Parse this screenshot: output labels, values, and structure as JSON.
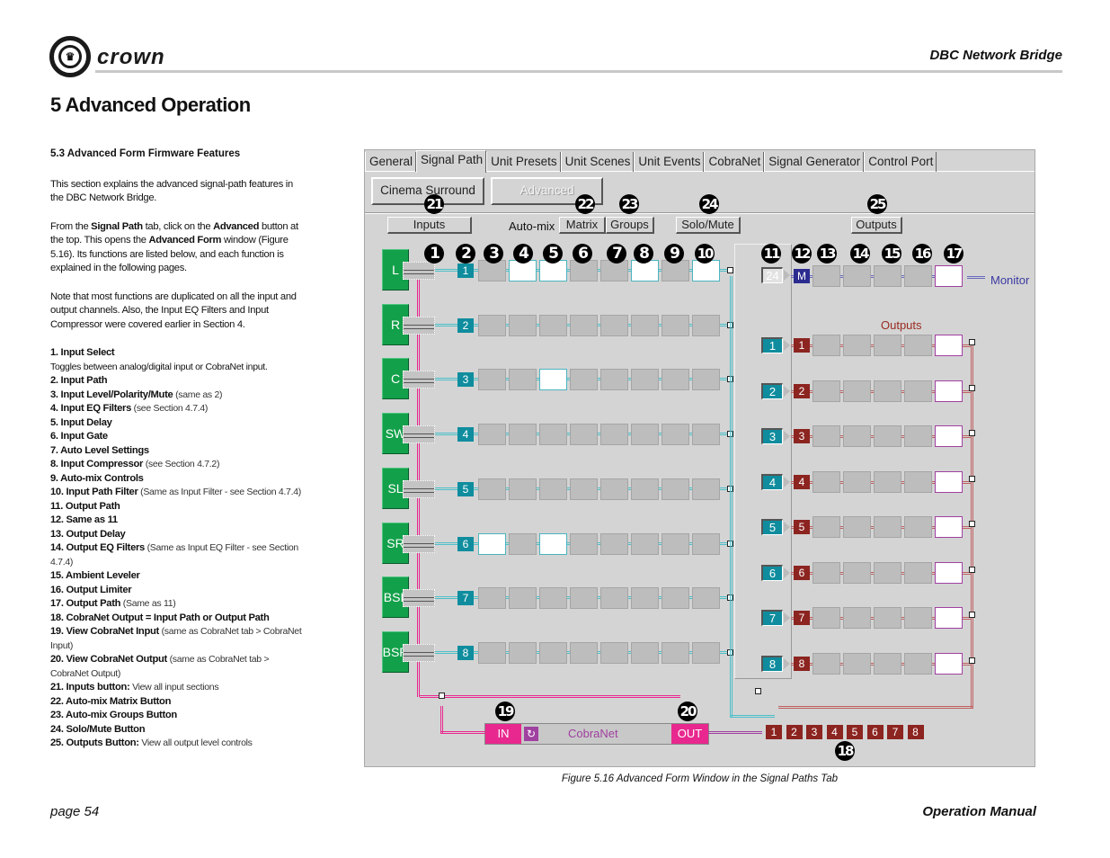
{
  "header": {
    "brand": "crown",
    "product": "DBC Network Bridge",
    "section_title": "5 Advanced Operation"
  },
  "left": {
    "subsection": "5.3 Advanced Form Firmware Features",
    "intro": "This section explains the advanced signal-path features in the DBC Network Bridge.",
    "para2": {
      "t1": "From the ",
      "b1": "Signal Path",
      "t2": " tab, click on the ",
      "b2": "Advanced",
      "t3": " button at the top. This opens the ",
      "b3": "Advanced Form",
      "t4": " window (Figure 5.16). Its functions are listed below, and each function is explained in the following pages."
    },
    "note": "Note that most functions are duplicated on all the input and output channels. Also, the Input EQ Filters and Input Compressor were covered earlier in Section 4.",
    "items": [
      {
        "title": "1. Input Select",
        "note": "",
        "desc": "Toggles between analog/digital input or CobraNet input."
      },
      {
        "title": "2. Input Path",
        "note": ""
      },
      {
        "title": "3. Input Level/Polarity/Mute",
        "note": " (same as 2)"
      },
      {
        "title": "4. Input EQ Filters",
        "note": " (see Section 4.7.4)"
      },
      {
        "title": "5. Input Delay",
        "note": ""
      },
      {
        "title": "6. Input Gate",
        "note": ""
      },
      {
        "title": "7. Auto Level Settings",
        "note": ""
      },
      {
        "title": "8. Input Compressor",
        "note": " (see Section 4.7.2)"
      },
      {
        "title": "9. Auto-mix Controls",
        "note": ""
      },
      {
        "title": "10. Input Path Filter",
        "note": " (Same as Input Filter - see Section 4.7.4)"
      },
      {
        "title": "11. Output Path",
        "note": ""
      },
      {
        "title": "12. Same as 11",
        "note": ""
      },
      {
        "title": "13. Output Delay",
        "note": ""
      },
      {
        "title": "14. Output EQ Filters",
        "note": " (Same as Input EQ Filter - see Section 4.7.4)"
      },
      {
        "title": "15. Ambient Leveler",
        "note": ""
      },
      {
        "title": "16. Output Limiter",
        "note": ""
      },
      {
        "title": "17. Output Path",
        "note": " (Same as 11)"
      },
      {
        "title": "18. CobraNet Output = Input Path or Output Path",
        "note": ""
      },
      {
        "title": "19. View CobraNet Input",
        "note": " (same as CobraNet tab > CobraNet Input)"
      },
      {
        "title": "20. View CobraNet Output",
        "note": " (same as CobraNet tab > CobraNet Output)"
      },
      {
        "title": "21. Inputs button:",
        "note": " View all input sections"
      },
      {
        "title": "22. Auto-mix Matrix Button",
        "note": ""
      },
      {
        "title": "23. Auto-mix Groups Button",
        "note": ""
      },
      {
        "title": "24. Solo/Mute Button",
        "note": ""
      },
      {
        "title": "25. Outputs Button:",
        "note": " View all output level controls"
      }
    ]
  },
  "figure": {
    "tabs": [
      "General",
      "Signal Path",
      "Unit Presets",
      "Unit Scenes",
      "Unit Events",
      "CobraNet",
      "Signal Generator",
      "Control Port"
    ],
    "active_tab": "Signal Path",
    "buttons": {
      "cinema_surround": "Cinema Surround",
      "advanced": "Advanced",
      "inputs": "Inputs",
      "automix_label": "Auto-mix",
      "matrix": "Matrix",
      "groups": "Groups",
      "solo_mute": "Solo/Mute",
      "outputs": "Outputs"
    },
    "callouts": [
      "1",
      "2",
      "3",
      "4",
      "5",
      "6",
      "7",
      "8",
      "9",
      "10",
      "11",
      "12",
      "13",
      "14",
      "15",
      "16",
      "17",
      "18",
      "19",
      "20",
      "21",
      "22",
      "23",
      "24",
      "25"
    ],
    "inputs": [
      {
        "source": "L",
        "channel": "1"
      },
      {
        "source": "R",
        "channel": "2"
      },
      {
        "source": "C",
        "channel": "3"
      },
      {
        "source": "SW",
        "channel": "4"
      },
      {
        "source": "SL",
        "channel": "5"
      },
      {
        "source": "SR",
        "channel": "6"
      },
      {
        "source": "BSL",
        "channel": "7"
      },
      {
        "source": "BSR",
        "channel": "8"
      }
    ],
    "monitor": {
      "source": "24",
      "channel": "M",
      "label": "Monitor"
    },
    "outputs_label": "Outputs",
    "outputs": [
      "1",
      "2",
      "3",
      "4",
      "5",
      "6",
      "7",
      "8"
    ],
    "cobranet": {
      "in": "IN",
      "label": "CobraNet",
      "out": "OUT"
    },
    "cobranet_outputs": [
      "1",
      "2",
      "3",
      "4",
      "5",
      "6",
      "7",
      "8"
    ],
    "colors": {
      "panel": "#d4d4d4",
      "source_green": "#13a04a",
      "channel_teal": "#0f8d9e",
      "output_red": "#8c2420",
      "monitor_blue": "#2c2c90",
      "cobranet_magenta": "#e8288e",
      "monitor_text": "#3a3aa0",
      "outputs_text": "#9a2a20"
    }
  },
  "caption": "Figure 5.16  Advanced Form Window in the Signal Paths Tab",
  "footer": {
    "page": "page 54",
    "manual": "Operation Manual"
  }
}
